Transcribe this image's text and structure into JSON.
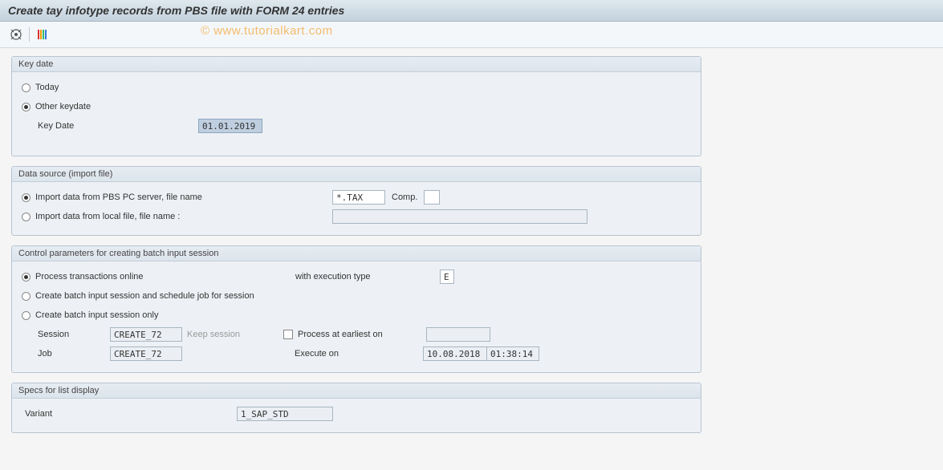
{
  "title": "Create tay infotype records from PBS file with FORM 24 entries",
  "watermark": "© www.tutorialkart.com",
  "group1": {
    "title": "Key date",
    "opt_today": "Today",
    "opt_other": "Other keydate",
    "keydate_label": "Key Date",
    "keydate_value": "01.01.2019"
  },
  "group2": {
    "title": "Data source (import file)",
    "opt_pbs": "Import data from PBS PC server, file name",
    "opt_local": "Import data from local file, file name     :",
    "file_value": "*.TAX",
    "comp_label": "Comp.",
    "comp_value": "",
    "local_value": ""
  },
  "group3": {
    "title": "Control parameters for creating batch input session",
    "opt_online": "Process transactions online",
    "exec_type_label": "with execution type",
    "exec_type_value": "E",
    "opt_schedule": "Create batch input session and schedule job for session",
    "opt_session_only": "Create batch input session only",
    "session_label": "Session",
    "session_value": "CREATE_72",
    "keep_session": "Keep session",
    "process_earliest_label": "Process at earliest on",
    "process_earliest_value": "",
    "job_label": "Job",
    "job_value": "CREATE_72",
    "execute_on_label": "Execute on",
    "execute_date": "10.08.2018",
    "execute_time": "01:38:14"
  },
  "group4": {
    "title": "Specs for list display",
    "variant_label": "Variant",
    "variant_value": "1_SAP_STD"
  }
}
